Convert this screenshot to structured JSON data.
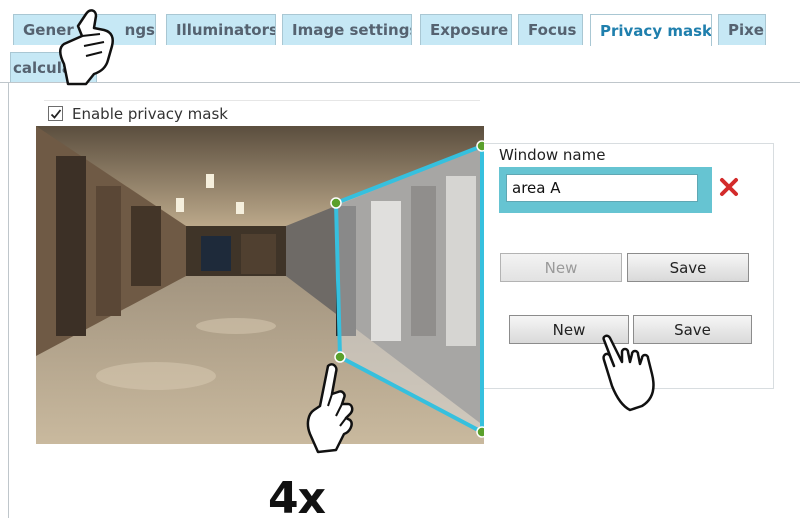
{
  "tabs": [
    {
      "label": "General settings",
      "active": false
    },
    {
      "label": "Illuminators",
      "active": false
    },
    {
      "label": "Image settings",
      "active": false
    },
    {
      "label": "Exposure",
      "active": false
    },
    {
      "label": "Focus",
      "active": false
    },
    {
      "label": "Privacy mask",
      "active": true
    },
    {
      "label": "Pixel calculator",
      "active": false
    }
  ],
  "tab_wrap_label": "calculator",
  "tab_first_visible": "Gener",
  "tab_first_visible_tail": "ngs",
  "tab_last_visible": "Pixel",
  "privacy": {
    "enable_label": "Enable privacy mask",
    "enabled": true
  },
  "mask_window": {
    "name_label": "Window name",
    "name_value": "area A"
  },
  "buttons": {
    "new_disabled": "New",
    "save_1": "Save",
    "new_2": "New",
    "save_2": "Save"
  },
  "multiplier_text": "4x",
  "colors": {
    "tab_bg": "#c6e8f5",
    "tab_active_text": "#1f7fad",
    "mask_outline": "#36c0de",
    "mask_handle": "#5aa02c",
    "input_frame": "#66c4d2",
    "delete_x": "#d32b2b"
  },
  "icons": [
    "pointing-hand-icon",
    "check-icon",
    "delete-x-icon"
  ]
}
